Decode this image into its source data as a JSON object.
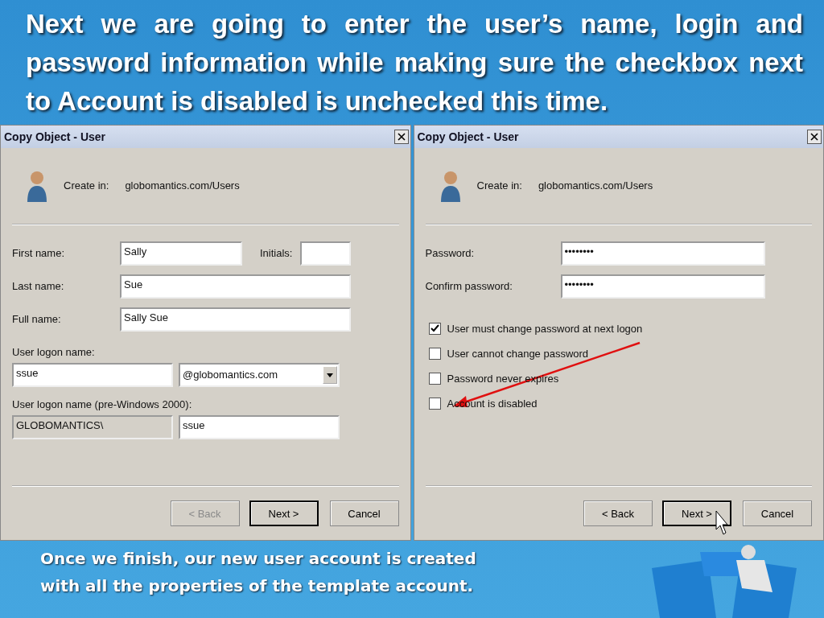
{
  "heading": "Next we are going to enter the user’s name, login and password information while making sure the checkbox next to Account is disabled is unchecked this time.",
  "dialogs": [
    {
      "kind": "names",
      "title": "Copy Object - User",
      "create_in_label": "Create in:",
      "create_in_value": "globomantics.com/Users",
      "first_name": {
        "label": "First name:",
        "value": "Sally"
      },
      "initials": {
        "label": "Initials:"
      },
      "last_name": {
        "label": "Last name:",
        "value": "Sue"
      },
      "full_name": {
        "label": "Full name:",
        "value": "Sally Sue"
      },
      "logon_label": "User logon name:",
      "logon_value": "ssue",
      "domain": "@globomantics.com",
      "pre2000_label": "User logon name (pre-Windows 2000):",
      "pre2000_domain": "GLOBOMANTICS\\",
      "pre2000_value": "ssue",
      "buttons": [
        {
          "label": "< Back",
          "disabled": true,
          "default": false
        },
        {
          "label": "Next >",
          "disabled": false,
          "default": true
        },
        {
          "label": "Cancel",
          "disabled": false,
          "default": false
        }
      ]
    },
    {
      "kind": "password",
      "title": "Copy Object - User",
      "create_in_label": "Create in:",
      "create_in_value": "globomantics.com/Users",
      "password": {
        "label": "Password:",
        "value": "••••••••"
      },
      "confirm": {
        "label": "Confirm password:",
        "value": "••••••••"
      },
      "options": [
        {
          "label": "User must change password at next logon",
          "checked": true
        },
        {
          "label": "User cannot change password",
          "checked": false
        },
        {
          "label": "Password never expires",
          "checked": false
        },
        {
          "label": "Account is disabled",
          "checked": false
        }
      ],
      "buttons": [
        {
          "label": "< Back",
          "disabled": false,
          "default": false
        },
        {
          "label": "Next >",
          "disabled": false,
          "default": true
        },
        {
          "label": "Cancel",
          "disabled": false,
          "default": false
        }
      ]
    }
  ],
  "footer": [
    "Once we finish, our new user account is created",
    "with all the properties of the template account."
  ]
}
